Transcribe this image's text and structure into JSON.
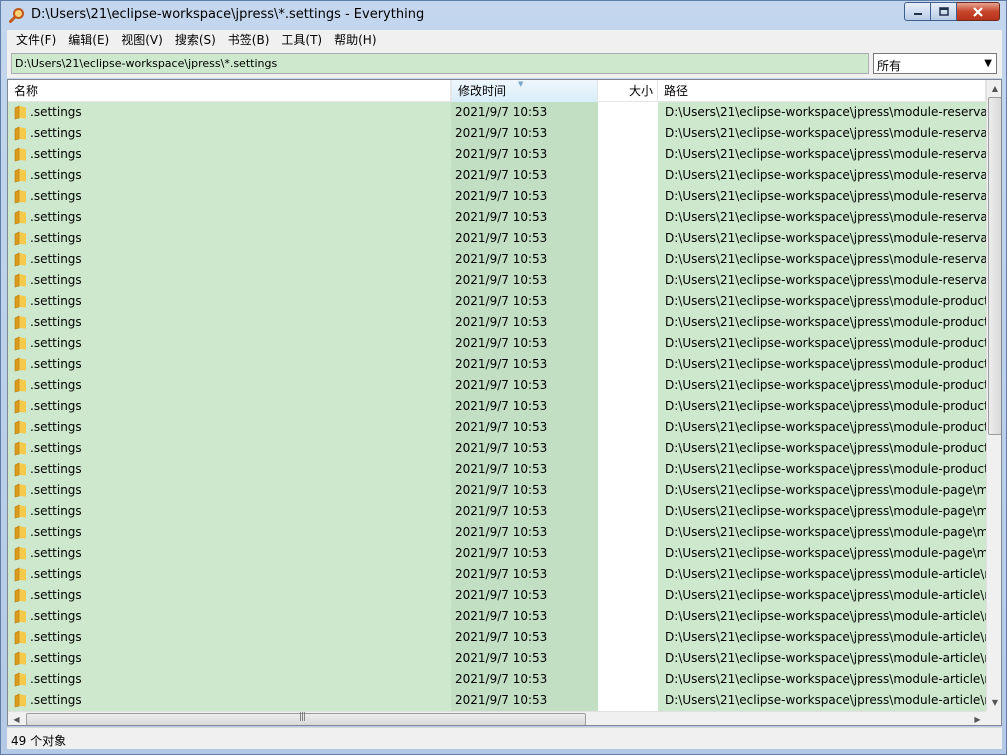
{
  "window": {
    "title": "D:\\Users\\21\\eclipse-workspace\\jpress\\*.settings - Everything",
    "icon": "search-magnifier-icon"
  },
  "menu": [
    {
      "label": "文件(F)"
    },
    {
      "label": "编辑(E)"
    },
    {
      "label": "视图(V)"
    },
    {
      "label": "搜索(S)"
    },
    {
      "label": "书签(B)"
    },
    {
      "label": "工具(T)"
    },
    {
      "label": "帮助(H)"
    }
  ],
  "search": {
    "value": "D:\\Users\\21\\eclipse-workspace\\jpress\\*.settings",
    "filter": "所有"
  },
  "columns": {
    "name": "名称",
    "date": "修改时间",
    "size": "大小",
    "path": "路径"
  },
  "rows": [
    {
      "name": ".settings",
      "date": "2021/9/7 10:53",
      "path": "D:\\Users\\21\\eclipse-workspace\\jpress\\module-reservation"
    },
    {
      "name": ".settings",
      "date": "2021/9/7 10:53",
      "path": "D:\\Users\\21\\eclipse-workspace\\jpress\\module-reservation"
    },
    {
      "name": ".settings",
      "date": "2021/9/7 10:53",
      "path": "D:\\Users\\21\\eclipse-workspace\\jpress\\module-reservation"
    },
    {
      "name": ".settings",
      "date": "2021/9/7 10:53",
      "path": "D:\\Users\\21\\eclipse-workspace\\jpress\\module-reservation"
    },
    {
      "name": ".settings",
      "date": "2021/9/7 10:53",
      "path": "D:\\Users\\21\\eclipse-workspace\\jpress\\module-reservation"
    },
    {
      "name": ".settings",
      "date": "2021/9/7 10:53",
      "path": "D:\\Users\\21\\eclipse-workspace\\jpress\\module-reservation"
    },
    {
      "name": ".settings",
      "date": "2021/9/7 10:53",
      "path": "D:\\Users\\21\\eclipse-workspace\\jpress\\module-reservation"
    },
    {
      "name": ".settings",
      "date": "2021/9/7 10:53",
      "path": "D:\\Users\\21\\eclipse-workspace\\jpress\\module-reservation"
    },
    {
      "name": ".settings",
      "date": "2021/9/7 10:53",
      "path": "D:\\Users\\21\\eclipse-workspace\\jpress\\module-reservation"
    },
    {
      "name": ".settings",
      "date": "2021/9/7 10:53",
      "path": "D:\\Users\\21\\eclipse-workspace\\jpress\\module-product"
    },
    {
      "name": ".settings",
      "date": "2021/9/7 10:53",
      "path": "D:\\Users\\21\\eclipse-workspace\\jpress\\module-product"
    },
    {
      "name": ".settings",
      "date": "2021/9/7 10:53",
      "path": "D:\\Users\\21\\eclipse-workspace\\jpress\\module-product"
    },
    {
      "name": ".settings",
      "date": "2021/9/7 10:53",
      "path": "D:\\Users\\21\\eclipse-workspace\\jpress\\module-product"
    },
    {
      "name": ".settings",
      "date": "2021/9/7 10:53",
      "path": "D:\\Users\\21\\eclipse-workspace\\jpress\\module-product"
    },
    {
      "name": ".settings",
      "date": "2021/9/7 10:53",
      "path": "D:\\Users\\21\\eclipse-workspace\\jpress\\module-product"
    },
    {
      "name": ".settings",
      "date": "2021/9/7 10:53",
      "path": "D:\\Users\\21\\eclipse-workspace\\jpress\\module-product"
    },
    {
      "name": ".settings",
      "date": "2021/9/7 10:53",
      "path": "D:\\Users\\21\\eclipse-workspace\\jpress\\module-product"
    },
    {
      "name": ".settings",
      "date": "2021/9/7 10:53",
      "path": "D:\\Users\\21\\eclipse-workspace\\jpress\\module-product"
    },
    {
      "name": ".settings",
      "date": "2021/9/7 10:53",
      "path": "D:\\Users\\21\\eclipse-workspace\\jpress\\module-page\\module-page"
    },
    {
      "name": ".settings",
      "date": "2021/9/7 10:53",
      "path": "D:\\Users\\21\\eclipse-workspace\\jpress\\module-page\\module-page"
    },
    {
      "name": ".settings",
      "date": "2021/9/7 10:53",
      "path": "D:\\Users\\21\\eclipse-workspace\\jpress\\module-page\\module-page"
    },
    {
      "name": ".settings",
      "date": "2021/9/7 10:53",
      "path": "D:\\Users\\21\\eclipse-workspace\\jpress\\module-page\\module-page"
    },
    {
      "name": ".settings",
      "date": "2021/9/7 10:53",
      "path": "D:\\Users\\21\\eclipse-workspace\\jpress\\module-article\\module-article"
    },
    {
      "name": ".settings",
      "date": "2021/9/7 10:53",
      "path": "D:\\Users\\21\\eclipse-workspace\\jpress\\module-article\\module-article"
    },
    {
      "name": ".settings",
      "date": "2021/9/7 10:53",
      "path": "D:\\Users\\21\\eclipse-workspace\\jpress\\module-article\\module-article"
    },
    {
      "name": ".settings",
      "date": "2021/9/7 10:53",
      "path": "D:\\Users\\21\\eclipse-workspace\\jpress\\module-article\\module-article"
    },
    {
      "name": ".settings",
      "date": "2021/9/7 10:53",
      "path": "D:\\Users\\21\\eclipse-workspace\\jpress\\module-article\\module-article"
    },
    {
      "name": ".settings",
      "date": "2021/9/7 10:53",
      "path": "D:\\Users\\21\\eclipse-workspace\\jpress\\module-article\\module-article"
    },
    {
      "name": ".settings",
      "date": "2021/9/7 10:53",
      "path": "D:\\Users\\21\\eclipse-workspace\\jpress\\module-article\\module-article"
    }
  ],
  "status": {
    "text": "49 个对象"
  },
  "colors": {
    "highlight": "#cde8cd",
    "sorted_column": "#c2dfc4",
    "folder": "#e8b83a"
  }
}
